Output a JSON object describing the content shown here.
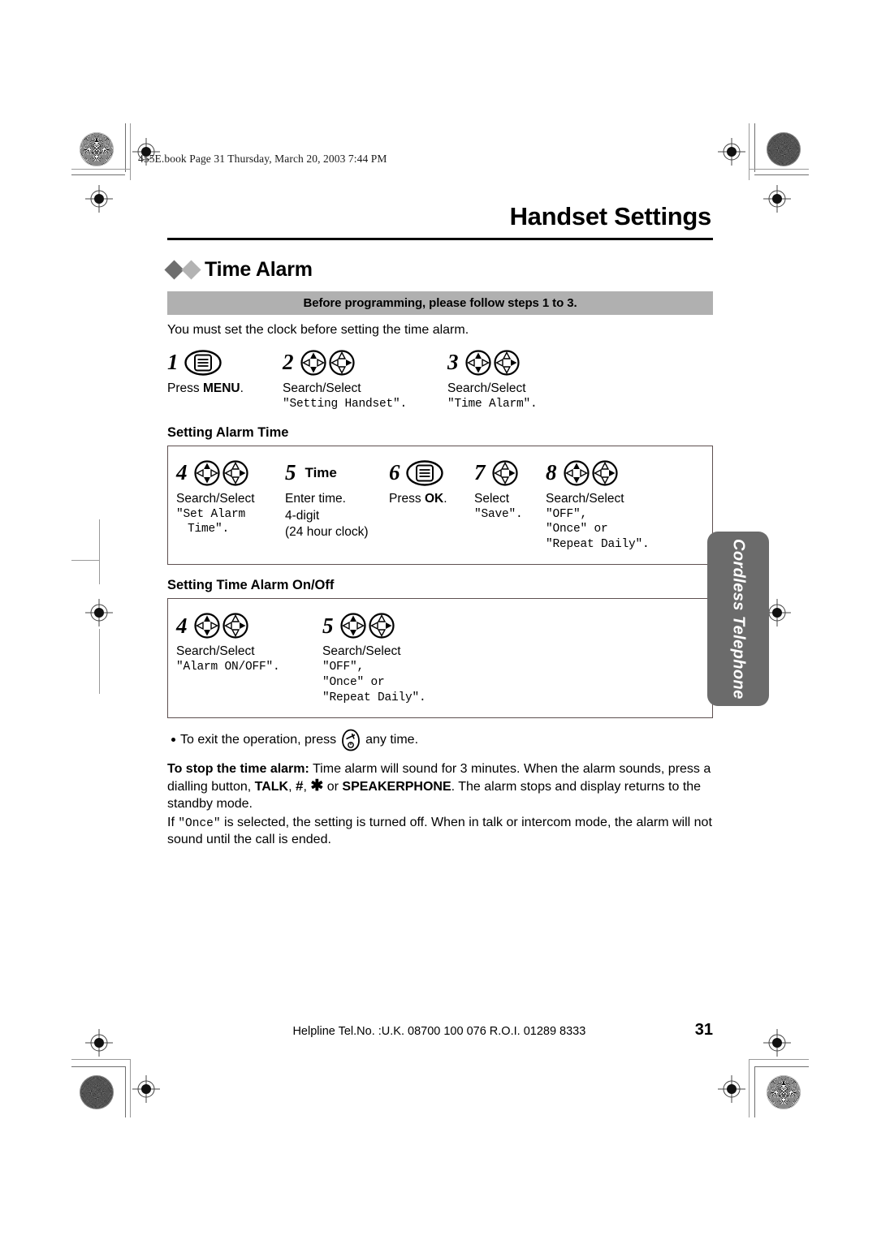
{
  "header": {
    "file_stamp": "455E.book  Page 31  Thursday, March 20, 2003  7:44 PM"
  },
  "chapter": {
    "title": "Handset Settings"
  },
  "section": {
    "title": "Time Alarm",
    "banner": "Before programming, please follow steps 1 to 3.",
    "lead": "You must set the clock before setting the time alarm."
  },
  "intro_steps": [
    {
      "number": "1",
      "icon": "menu-key-icon",
      "caption_plain": "Press ",
      "caption_bold": "MENU",
      "caption_tail": ".",
      "display": ""
    },
    {
      "number": "2",
      "icon": "navigator-pair-icon",
      "caption_plain": "Search/Select",
      "caption_bold": "",
      "caption_tail": "",
      "display": "\"Setting Handset\"."
    },
    {
      "number": "3",
      "icon": "navigator-pair-icon",
      "caption_plain": "Search/Select",
      "caption_bold": "",
      "caption_tail": "",
      "display": "\"Time Alarm\"."
    }
  ],
  "procedure_alarm_time": {
    "heading": "Setting Alarm Time",
    "steps": [
      {
        "number": "4",
        "icon": "navigator-pair-icon",
        "caption": "Search/Select",
        "display_line1": "\"Set Alarm",
        "display_line2": "Time\"."
      },
      {
        "number": "5",
        "icon": "time-word-icon",
        "icon_label": "Time",
        "caption": "Enter time.",
        "display_line1": "4-digit",
        "display_line2": "(24 hour clock)"
      },
      {
        "number": "6",
        "icon": "menu-key-icon",
        "caption_plain": "Press ",
        "caption_bold": "OK",
        "caption_tail": ".",
        "display_line1": "",
        "display_line2": ""
      },
      {
        "number": "7",
        "icon": "navigator-right-icon",
        "caption": "Select",
        "display_line1": "\"Save\".",
        "display_line2": ""
      },
      {
        "number": "8",
        "icon": "navigator-pair-icon",
        "caption": "Search/Select",
        "display_line1": "\"OFF\",",
        "display_line2": "\"Once\" or",
        "display_line3": "\"Repeat Daily\"."
      }
    ]
  },
  "procedure_alarm_onoff": {
    "heading": "Setting Time Alarm On/Off",
    "steps": [
      {
        "number": "4",
        "icon": "navigator-pair-icon",
        "caption": "Search/Select",
        "display_line1": "\"Alarm ON/OFF\".",
        "display_line2": "",
        "display_line3": ""
      },
      {
        "number": "5",
        "icon": "navigator-pair-icon",
        "caption": "Search/Select",
        "display_line1": "\"OFF\",",
        "display_line2": "\"Once\" or",
        "display_line3": "\"Repeat Daily\"."
      }
    ]
  },
  "notes": {
    "exit_prefix": "To exit the operation, press",
    "exit_icon": "off-key-icon",
    "exit_suffix": "any time.",
    "stop_label": "To stop the time alarm:",
    "stop_text_1": " Time alarm will sound for 3 minutes. When the alarm sounds, press a dialling button, ",
    "stop_talk": "TALK",
    "stop_comma": ", ",
    "stop_hash": "#",
    "stop_comma2": ", ",
    "stop_star": "✱",
    "stop_or": " or ",
    "stop_speakerphone": "SPEAKERPHONE",
    "stop_text_2": ". The alarm stops and display returns to the standby mode.",
    "once_prefix": "If ",
    "once_mono": "\"Once\"",
    "once_suffix": " is selected, the setting is turned off. When in talk or intercom mode, the alarm will not sound until the call is ended."
  },
  "side_tab": {
    "label": "Cordless Telephone"
  },
  "footer": {
    "helpline": "Helpline Tel.No. :U.K. 08700 100 076  R.O.I. 01289 8333",
    "page_number": "31"
  },
  "colors": {
    "banner_gray": "#b0b0b0",
    "diamond_dark": "#6e6e6e",
    "diamond_light": "#b3b3b3",
    "side_tab_gray": "#6b6b6b",
    "box_border": "#5e5050"
  }
}
